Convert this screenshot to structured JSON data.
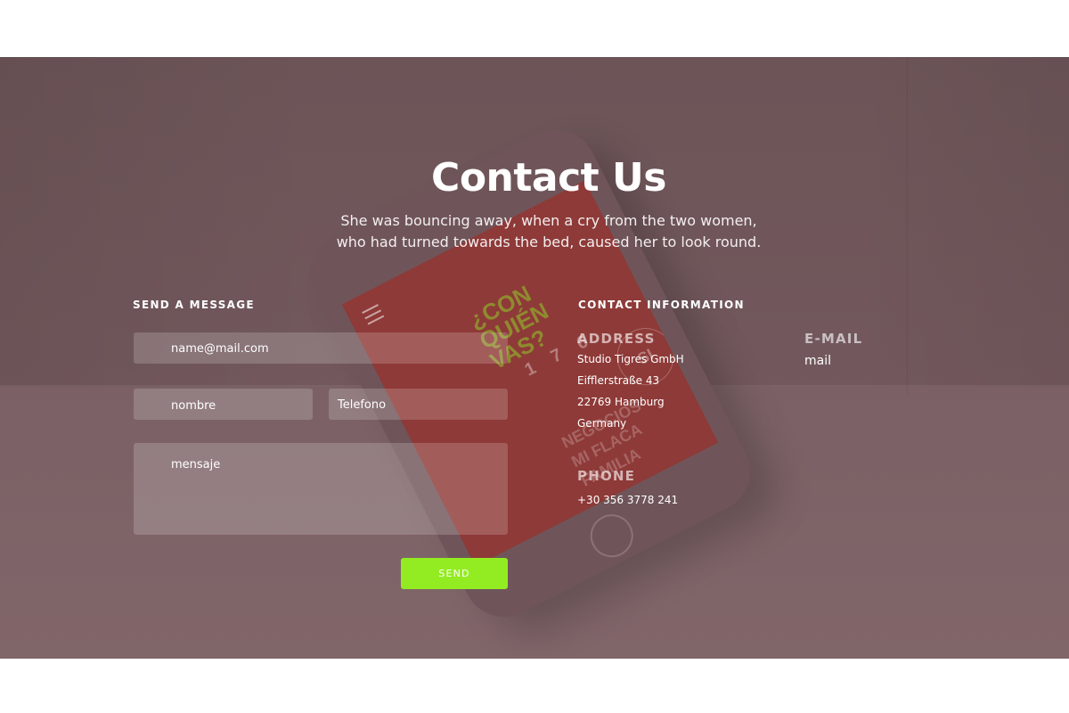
{
  "header": {
    "title": "Contact Us",
    "subtitle_line1": "She was bouncing away, when a cry from the two women,",
    "subtitle_line2": "who had turned towards the bed, caused her to look round."
  },
  "form": {
    "section_label": "SEND A MESSAGE",
    "email_placeholder": "name@mail.com",
    "name_placeholder": "nombre",
    "phone_placeholder": "Telefono",
    "message_placeholder": "mensaje",
    "send_label": "SEND"
  },
  "contact": {
    "section_label": "CONTACT INFORMATION",
    "address_heading": "ADDRESS",
    "address_lines": [
      "Studio Tigres GmbH",
      "Eifflerstraße 43",
      "22769 Hamburg",
      "Germany"
    ],
    "phone_heading": "PHONE",
    "phone_value": "+30 356 3778 241",
    "email_heading": "E-MAIL",
    "email_value": "mail"
  },
  "phone_mockup": {
    "headline": "¿CON QUIÉN VAS?",
    "number": "1 7 6",
    "badge": "SI",
    "list": [
      "NEGOCIOS",
      "MI FLACA",
      "FAMILIA"
    ]
  },
  "colors": {
    "background": "#72585c",
    "accent": "#93ec22",
    "phone_screen": "#8e3a38"
  }
}
